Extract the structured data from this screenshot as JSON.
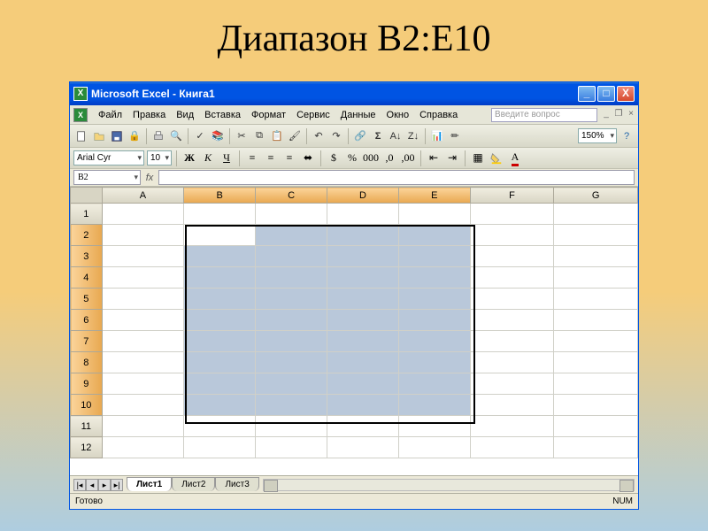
{
  "slide": {
    "title": "Диапазон В2:Е10"
  },
  "window": {
    "title": "Microsoft Excel - Книга1"
  },
  "menu": {
    "items": [
      "Файл",
      "Правка",
      "Вид",
      "Вставка",
      "Формат",
      "Сервис",
      "Данные",
      "Окно",
      "Справка"
    ],
    "help_placeholder": "Введите вопрос"
  },
  "toolbar": {
    "zoom": "150%"
  },
  "format": {
    "font": "Arial Cyr",
    "size": "10"
  },
  "namebox": {
    "value": "B2"
  },
  "grid": {
    "columns": [
      "A",
      "B",
      "C",
      "D",
      "E",
      "F",
      "G"
    ],
    "rows": [
      "1",
      "2",
      "3",
      "4",
      "5",
      "6",
      "7",
      "8",
      "9",
      "10",
      "11",
      "12"
    ],
    "selected_cols": [
      "B",
      "C",
      "D",
      "E"
    ],
    "selected_rows": [
      "2",
      "3",
      "4",
      "5",
      "6",
      "7",
      "8",
      "9",
      "10"
    ],
    "active_cell": "B2",
    "selection_range": "B2:E10"
  },
  "sheets": {
    "tabs": [
      "Лист1",
      "Лист2",
      "Лист3"
    ],
    "active": "Лист1"
  },
  "status": {
    "left": "Готово",
    "num": "NUM"
  },
  "window_controls": {
    "min": "_",
    "max": "□",
    "close": "X"
  },
  "doc_controls": {
    "min": "_",
    "restore": "❐",
    "close": "×"
  }
}
